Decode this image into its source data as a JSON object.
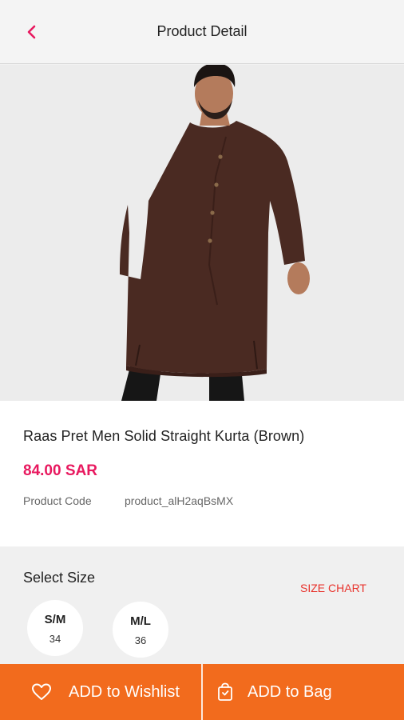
{
  "header": {
    "title": "Product Detail",
    "back_icon": "chevron-left-icon"
  },
  "product": {
    "name": "Raas Pret Men Solid Straight Kurta  (Brown)",
    "price": "84.00 SAR",
    "code_label": "Product Code",
    "code_value": "product_alH2aqBsMX"
  },
  "sizes": {
    "title": "Select Size",
    "chart_link": "SIZE CHART",
    "options": [
      {
        "label": "S/M",
        "number": "34"
      },
      {
        "label": "M/L",
        "number": "36"
      }
    ]
  },
  "actions": {
    "wishlist": {
      "label": "ADD to Wishlist",
      "icon": "heart-icon"
    },
    "bag": {
      "label": "ADD to Bag",
      "icon": "bag-icon"
    }
  },
  "colors": {
    "accent": "#e8195f",
    "action_bar": "#f26b1d",
    "size_chart": "#e8322b",
    "kurta": "#4a2a22"
  }
}
